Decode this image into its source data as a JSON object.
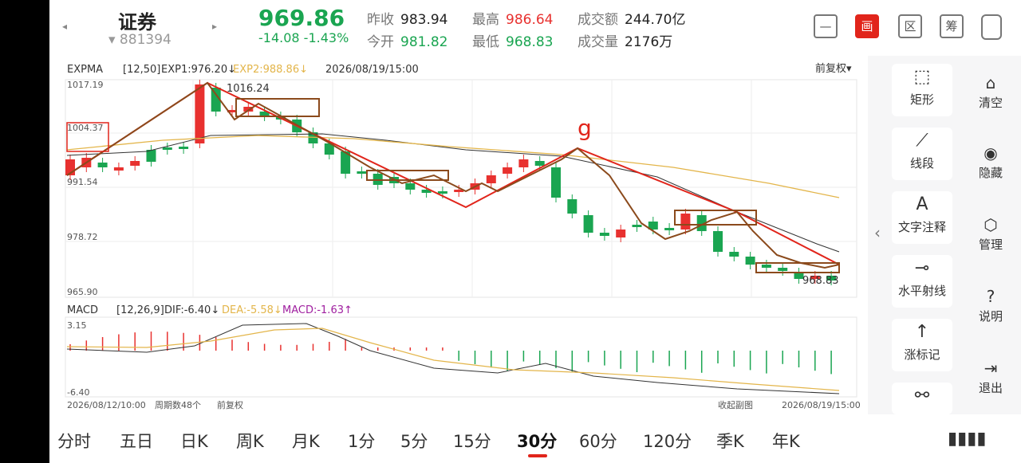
{
  "header": {
    "stock_name": "证券",
    "stock_code": "▾ 881394",
    "price": "969.86",
    "change": "-14.08  -1.43%",
    "prev_close_label": "昨收",
    "prev_close": "983.94",
    "open_label": "今开",
    "open": "981.82",
    "high_label": "最高",
    "high": "986.64",
    "low_label": "最低",
    "low": "968.83",
    "amount_label": "成交额",
    "amount": "244.70亿",
    "volume_label": "成交量",
    "volume": "2176万",
    "nav_prev": "◂",
    "nav_next": "▸",
    "tool_icons": [
      "minus-box-icon",
      "draw-icon",
      "region-icon",
      "chip-icon",
      "rotate-screen-icon"
    ],
    "tool_labels": [
      "—",
      "画",
      "区",
      "筹",
      ""
    ]
  },
  "chart_legend": {
    "indicator": "EXPMA",
    "params": "[12,50]",
    "exp1": "EXP1:976.20↓",
    "exp2": "EXP2:988.86↓",
    "datetime": "2026/08/19/15:00",
    "adjust": "前复权▾",
    "y_ticks": [
      "1017.19",
      "1004.37",
      "991.54",
      "978.72",
      "965.90"
    ],
    "peak_label": "1016.24",
    "last_label": "968.83",
    "annotation": "g"
  },
  "macd_legend": {
    "indicator": "MACD",
    "params": "[12,26,9]",
    "dif": "DIF:-6.40↓",
    "dea": "DEA:-5.58↓",
    "macd": "MACD:-1.63↑",
    "y_top": "3.15",
    "y_bottom": "-6.40"
  },
  "footer_axis": {
    "start": "2026/08/12/10:00",
    "period_count": "周期数48个",
    "adjust": "前复权",
    "collapse": "收起副图",
    "end": "2026/08/19/15:00"
  },
  "colors": {
    "up": "#e8312f",
    "down": "#1aa551",
    "exp1": "#333333",
    "exp2": "#e3b54a",
    "trend": "#e1251b",
    "wave": "#8b4a1c"
  },
  "right_panel": {
    "tools": [
      {
        "icon": "rectangle-icon",
        "glyph": "⬚",
        "label": "矩形"
      },
      {
        "icon": "line-segment-icon",
        "glyph": "⟋",
        "label": "线段"
      },
      {
        "icon": "text-annotation-icon",
        "glyph": "A",
        "label": "文字注释"
      },
      {
        "icon": "horizontal-ray-icon",
        "glyph": "⊸",
        "label": "水平射线"
      },
      {
        "icon": "rise-mark-icon",
        "glyph": "↑",
        "label": "涨标记"
      },
      {
        "icon": "more-icon",
        "glyph": "⚯",
        "label": ""
      }
    ],
    "side": [
      {
        "icon": "clear-icon",
        "glyph": "⌂",
        "label": "清空"
      },
      {
        "icon": "hide-icon",
        "glyph": "◉",
        "label": "隐藏"
      },
      {
        "icon": "manage-icon",
        "glyph": "⬡",
        "label": "管理"
      },
      {
        "icon": "help-icon",
        "glyph": "?",
        "label": "说明"
      },
      {
        "icon": "exit-icon",
        "glyph": "⇥",
        "label": "退出"
      }
    ],
    "collapse": "‹"
  },
  "periods": [
    "分时",
    "五日",
    "日K",
    "周K",
    "月K",
    "1分",
    "5分",
    "15分",
    "30分",
    "60分",
    "120分",
    "季K",
    "年K"
  ],
  "active_period": "30分",
  "bars_icon": "▮▮▮▮"
}
